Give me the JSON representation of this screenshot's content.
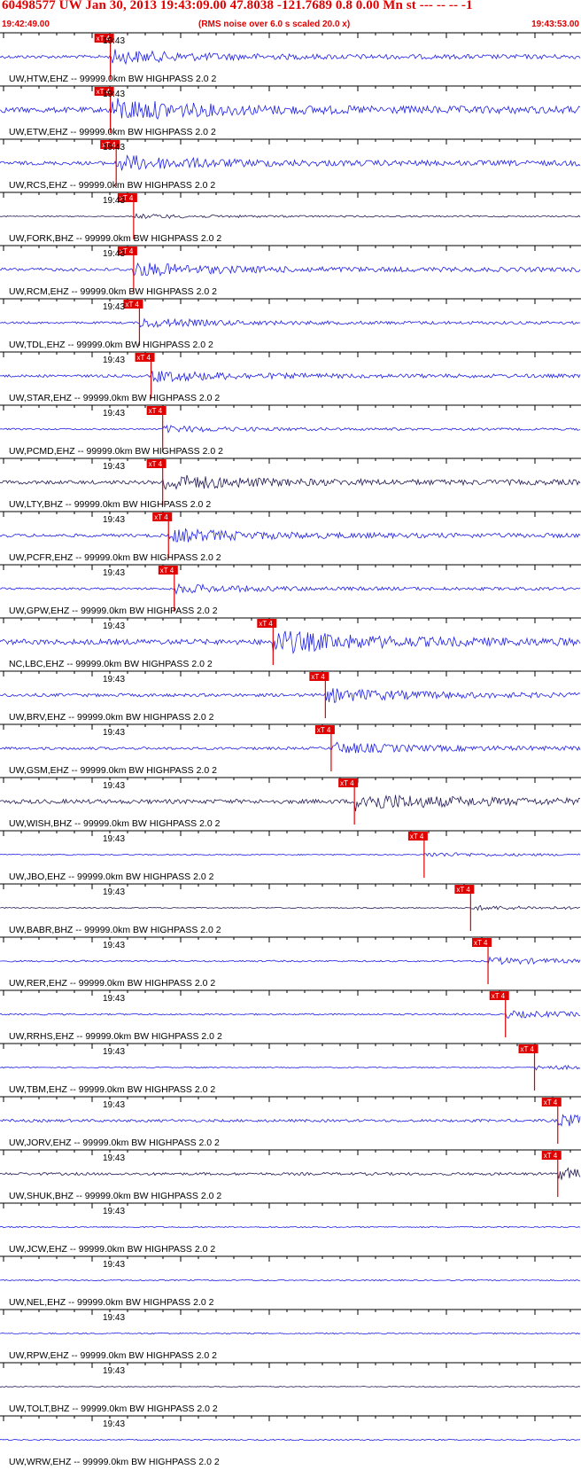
{
  "header": {
    "title": "60498577 UW Jan 30, 2013 19:43:09.00   47.8038 -121.7689  0.8 0.00 Mn st --- -- --  -1",
    "start_time": "19:42:49.00",
    "end_time": "19:43:53.00",
    "rms_note": "(RMS noise over 6.0 s scaled 20.0 x)"
  },
  "tick_time_label": "19:43",
  "pick_label": "xT 4",
  "colors": {
    "header_text": "#e00000",
    "trace_blue": "#1f1fe6",
    "trace_dark": "#231a55",
    "pick_red": "#e00000",
    "axis": "#000000"
  },
  "traces": [
    {
      "label": "UW,HTW,EHZ -- 99999.0km BW  HIGHPASS  2.0  2",
      "color": "blue",
      "pick": 0.19,
      "pick_kind": "Ep",
      "amp": 0.3
    },
    {
      "label": "UW,ETW,EHZ -- 99999.0km BW  HIGHPASS  2.0  2",
      "color": "blue",
      "pick": 0.19,
      "pick_kind": "Ep",
      "amp": 0.5
    },
    {
      "label": "UW,RCS,EHZ -- 99999.0km BW  HIGHPASS  2.0  2",
      "color": "blue",
      "pick": 0.2,
      "pick_kind": "xT 4",
      "amp": 0.35
    },
    {
      "label": "UW,FORK,BHZ -- 99999.0km BW  HIGHPASS  2.0  2",
      "color": "dark",
      "pick": 0.23,
      "pick_kind": "xT 4",
      "amp": 0.1
    },
    {
      "label": "UW,RCM,EHZ -- 99999.0km BW  HIGHPASS  2.0  2",
      "color": "blue",
      "pick": 0.23,
      "pick_kind": "xT 4",
      "amp": 0.3
    },
    {
      "label": "UW,TDL,EHZ -- 99999.0km BW  HIGHPASS  2.0  2",
      "color": "blue",
      "pick": 0.24,
      "pick_kind": "xT 4",
      "amp": 0.2
    },
    {
      "label": "UW,STAR,EHZ -- 99999.0km BW  HIGHPASS  2.0  2",
      "color": "blue",
      "pick": 0.26,
      "pick_kind": "xT 4",
      "amp": 0.25
    },
    {
      "label": "UW,PCMD,EHZ -- 99999.0km BW  HIGHPASS  2.0  2",
      "color": "blue",
      "pick": 0.28,
      "pick_kind": "xT 4",
      "amp": 0.15
    },
    {
      "label": "UW,LTY,BHZ -- 99999.0km BW  HIGHPASS  2.0  2",
      "color": "dark",
      "pick": 0.28,
      "pick_kind": "xT 4",
      "amp": 0.35
    },
    {
      "label": "UW,PCFR,EHZ -- 99999.0km BW  HIGHPASS  2.0  2",
      "color": "blue",
      "pick": 0.29,
      "pick_kind": "xT 4",
      "amp": 0.3
    },
    {
      "label": "UW,GPW,EHZ -- 99999.0km BW  HIGHPASS  2.0  2",
      "color": "blue",
      "pick": 0.3,
      "pick_kind": "xT 4",
      "amp": 0.2
    },
    {
      "label": "NC,LBC,EHZ -- 99999.0km BW  HIGHPASS  2.0  2",
      "color": "blue",
      "pick": 0.47,
      "pick_kind": "xT 4",
      "amp": 0.5
    },
    {
      "label": "UW,BRV,EHZ -- 99999.0km BW  HIGHPASS  2.0  2",
      "color": "blue",
      "pick": 0.56,
      "pick_kind": "xT 4",
      "amp": 0.3
    },
    {
      "label": "UW,GSM,EHZ -- 99999.0km BW  HIGHPASS  2.0  2",
      "color": "blue",
      "pick": 0.57,
      "pick_kind": "xT 4",
      "amp": 0.25
    },
    {
      "label": "UW,WISH,BHZ -- 99999.0km BW  HIGHPASS  2.0  2",
      "color": "dark",
      "pick": 0.61,
      "pick_kind": "xT 4",
      "amp": 0.4
    },
    {
      "label": "UW,JBO,EHZ -- 99999.0km BW  HIGHPASS  2.0  2",
      "color": "blue",
      "pick": 0.73,
      "pick_kind": "xT 4",
      "amp": 0.1
    },
    {
      "label": "UW,BABR,BHZ -- 99999.0km BW  HIGHPASS  2.0  2",
      "color": "dark",
      "pick": 0.81,
      "pick_kind": "xT 4",
      "amp": 0.1
    },
    {
      "label": "UW,RER,EHZ -- 99999.0km BW  HIGHPASS  2.0  2",
      "color": "blue",
      "pick": 0.84,
      "pick_kind": "xT 4",
      "amp": 0.15
    },
    {
      "label": "UW,RRHS,EHZ -- 99999.0km BW  HIGHPASS  2.0  2",
      "color": "blue",
      "pick": 0.87,
      "pick_kind": "xT 4",
      "amp": 0.15
    },
    {
      "label": "UW,TBM,EHZ -- 99999.0km BW  HIGHPASS  2.0  2",
      "color": "blue",
      "pick": 0.92,
      "pick_kind": "xT 4",
      "amp": 0.1
    },
    {
      "label": "UW,JORV,EHZ -- 99999.0km BW  HIGHPASS  2.0  2",
      "color": "blue",
      "pick": 0.96,
      "pick_kind": "xT 4",
      "amp": 0.25
    },
    {
      "label": "UW,SHUK,BHZ -- 99999.0km BW  HIGHPASS  2.0  2",
      "color": "dark",
      "pick": 0.96,
      "pick_kind": "xT 4",
      "amp": 0.25
    },
    {
      "label": "UW,JCW,EHZ -- 99999.0km BW  HIGHPASS  2.0  2",
      "color": "blue",
      "pick": null,
      "pick_kind": null,
      "amp": 0.12
    },
    {
      "label": "UW,NEL,EHZ -- 99999.0km BW  HIGHPASS  2.0  2",
      "color": "blue",
      "pick": null,
      "pick_kind": null,
      "amp": 0.12
    },
    {
      "label": "UW,RPW,EHZ -- 99999.0km BW  HIGHPASS  2.0  2",
      "color": "blue",
      "pick": null,
      "pick_kind": null,
      "amp": 0.12
    },
    {
      "label": "UW,TOLT,BHZ -- 99999.0km BW  HIGHPASS  2.0  2",
      "color": "dark",
      "pick": null,
      "pick_kind": null,
      "amp": 0.08
    },
    {
      "label": "UW,WRW,EHZ -- 99999.0km BW  HIGHPASS  2.0  2",
      "color": "blue",
      "pick": null,
      "pick_kind": null,
      "amp": 0.12
    }
  ]
}
